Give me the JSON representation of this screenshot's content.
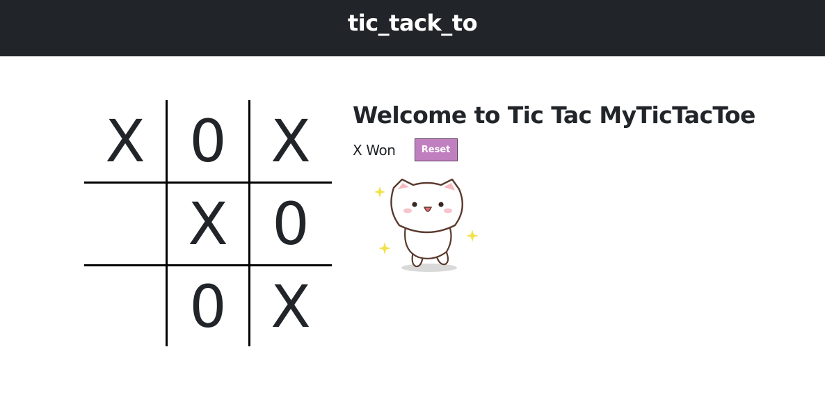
{
  "navbar": {
    "brand": "tic_tack_to"
  },
  "board": {
    "cells": [
      "X",
      "0",
      "X",
      "",
      "X",
      "0",
      "",
      "0",
      "X"
    ]
  },
  "info": {
    "title": "Welcome to Tic Tac MyTicTacToe",
    "status": "X Won",
    "reset_label": "Reset"
  },
  "colors": {
    "navbar_bg": "#212529",
    "reset_bg": "#c07fbf",
    "text": "#212529"
  },
  "icons": {
    "mascot": "happy-cat-illustration"
  }
}
